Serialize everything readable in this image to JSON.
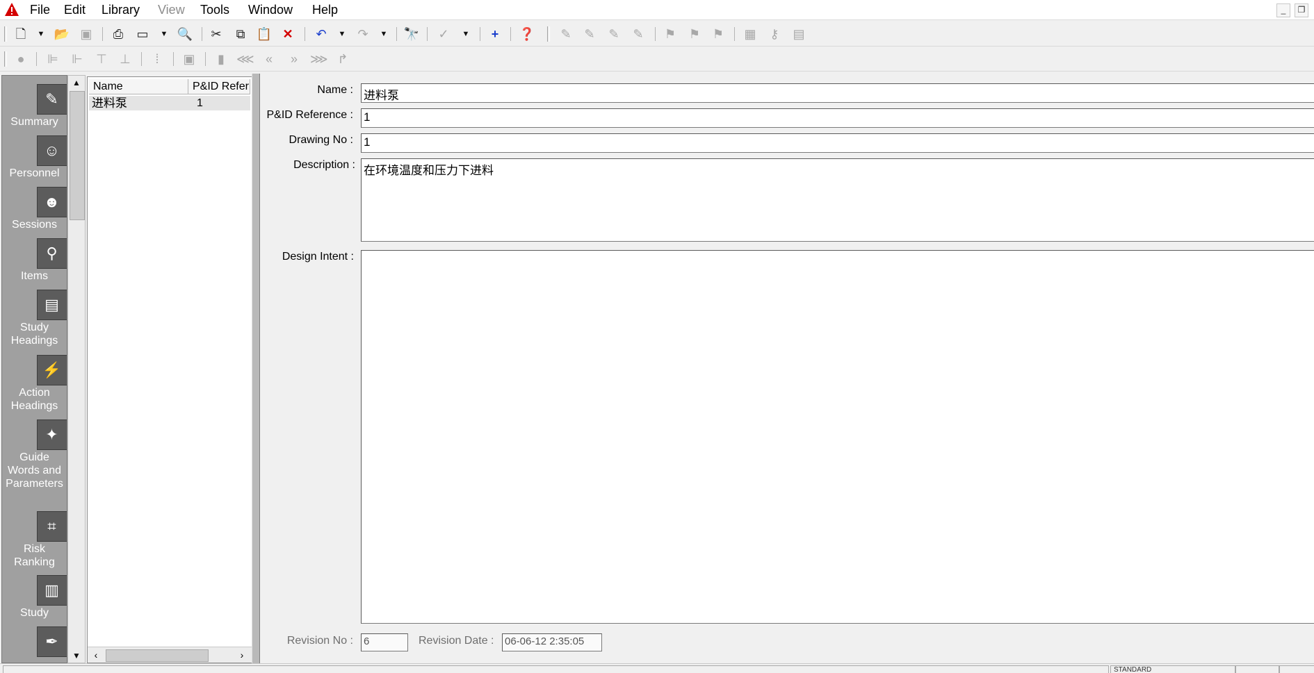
{
  "menu": {
    "items": [
      "File",
      "Edit",
      "Library",
      "View",
      "Tools",
      "Window",
      "Help"
    ]
  },
  "toolbar1": {
    "icons": [
      "new-document-icon",
      "dropdown-arrow-icon",
      "open-folder-icon",
      "save-icon",
      "print-icon",
      "window-layout-icon",
      "dropdown-arrow-icon",
      "print-preview-icon",
      "cut-icon",
      "copy-icon",
      "paste-icon",
      "delete-icon",
      "undo-icon",
      "dropdown-arrow-icon",
      "redo-icon",
      "dropdown-arrow-icon",
      "find-icon",
      "spell-check-icon",
      "dropdown-arrow-icon",
      "add-icon",
      "help-icon",
      "worksheet-icon",
      "worksheet-add-icon",
      "worksheet-insert-icon",
      "worksheet-delete-icon",
      "flag-icon",
      "flag-add-icon",
      "flag-delete-icon",
      "grid-icon",
      "key-icon",
      "calendar-icon"
    ]
  },
  "toolbar2": {
    "icons": [
      "record-icon",
      "align-left-icon",
      "align-right-icon",
      "align-top-icon",
      "align-bottom-icon",
      "grid-dots-icon",
      "layout-icon",
      "book-icon",
      "first-icon",
      "previous-icon",
      "next-icon",
      "last-icon",
      "jump-icon"
    ]
  },
  "nav": {
    "items": [
      {
        "label": "Summary",
        "icon": "summary-icon"
      },
      {
        "label": "Personnel",
        "icon": "personnel-icon"
      },
      {
        "label": "Sessions",
        "icon": "sessions-icon"
      },
      {
        "label": "Items",
        "icon": "items-icon"
      },
      {
        "label": "Study\nHeadings",
        "icon": "study-headings-icon"
      },
      {
        "label": "Action\nHeadings",
        "icon": "action-headings-icon"
      },
      {
        "label": "Guide\nWords and\nParameters",
        "icon": "guide-words-icon"
      },
      {
        "label": "Risk\nRanking",
        "icon": "risk-ranking-icon"
      },
      {
        "label": "Study",
        "icon": "study-icon"
      },
      {
        "label": "",
        "icon": "action-icon"
      }
    ]
  },
  "list": {
    "columns": [
      "Name",
      "P&ID Refer"
    ],
    "rows": [
      {
        "name": "进料泵",
        "pid": "1"
      }
    ]
  },
  "form": {
    "name_label": "Name :",
    "name_value": "进料泵",
    "pid_label": "P&ID Reference :",
    "pid_value": "1",
    "drawing_label": "Drawing No :",
    "drawing_value": "1",
    "description_label": "Description :",
    "description_value": "在环境温度和压力下进料",
    "design_intent_label": "Design Intent :",
    "design_intent_value": "",
    "revision_no_label": "Revision No :",
    "revision_no_value": "6",
    "revision_date_label": "Revision Date :",
    "revision_date_value": "06-06-12 2:35:05"
  },
  "status": {
    "panes": [
      "STANDARD"
    ]
  },
  "colors": {
    "nav_bg": "#a0a0a0",
    "alert_red": "#d40000",
    "accent_blue": "#1a3ecc"
  }
}
